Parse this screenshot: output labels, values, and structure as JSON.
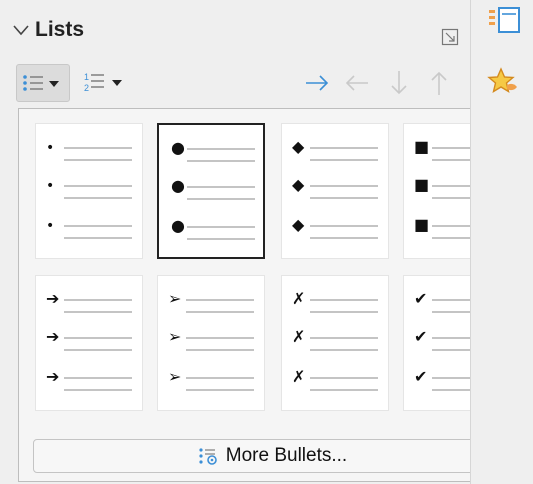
{
  "panel": {
    "title": "Lists"
  },
  "toolbar": {
    "bullet_button_icon": "unordered-list-icon",
    "numbering_button_icon": "ordered-list-icon",
    "actions": [
      {
        "name": "demote-indent",
        "icon": "arrow-right-icon"
      },
      {
        "name": "promote-indent",
        "icon": "arrow-left-icon"
      },
      {
        "name": "move-down",
        "icon": "arrow-down-icon"
      },
      {
        "name": "move-up",
        "icon": "arrow-up-icon"
      }
    ],
    "accent_color": "#3c8fd6"
  },
  "bullet_styles": [
    {
      "id": "small-dot",
      "glyph": "•",
      "selected": false
    },
    {
      "id": "large-dot",
      "glyph": "●",
      "selected": true
    },
    {
      "id": "diamond",
      "glyph": "◆",
      "selected": false
    },
    {
      "id": "square",
      "glyph": "■",
      "selected": false
    },
    {
      "id": "bold-arrow",
      "glyph": "➔",
      "selected": false
    },
    {
      "id": "arrowhead",
      "glyph": "➢",
      "selected": false
    },
    {
      "id": "cross",
      "glyph": "✗",
      "selected": false
    },
    {
      "id": "check",
      "glyph": "✔",
      "selected": false
    }
  ],
  "more_bullets_label": "More Bullets...",
  "sidebar_right": {
    "icons": [
      "properties-icon",
      "styles-star-icon"
    ]
  }
}
